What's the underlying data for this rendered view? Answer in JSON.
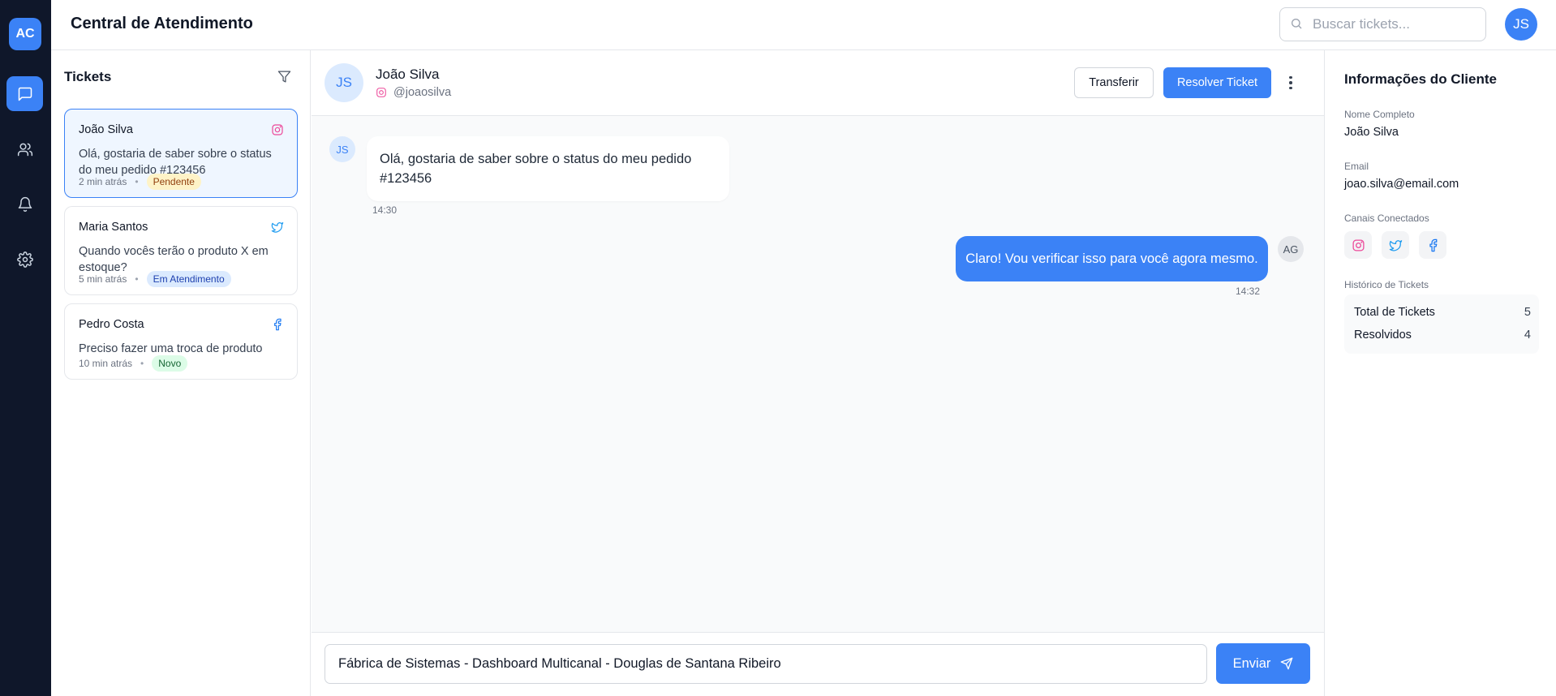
{
  "app": {
    "logo": "AC",
    "title": "Central de Atendimento",
    "user_avatar": "JS"
  },
  "search": {
    "placeholder": "Buscar tickets...",
    "icon": "search-icon"
  },
  "nav": {
    "items": [
      {
        "name": "messages",
        "icon": "message-square-icon",
        "active": true
      },
      {
        "name": "users",
        "icon": "users-icon",
        "active": false
      },
      {
        "name": "notifications",
        "icon": "bell-icon",
        "active": false
      },
      {
        "name": "settings",
        "icon": "gear-icon",
        "active": false
      }
    ]
  },
  "tickets": {
    "title": "Tickets",
    "items": [
      {
        "name": "João Silva",
        "channel": "instagram",
        "message": "Olá, gostaria de saber sobre o status do meu pedido #123456",
        "time": "2 min atrás",
        "status": "Pendente",
        "selected": true
      },
      {
        "name": "Maria Santos",
        "channel": "twitter",
        "message": "Quando vocês terão o produto X em estoque?",
        "time": "5 min atrás",
        "status": "Em Atendimento",
        "selected": false
      },
      {
        "name": "Pedro Costa",
        "channel": "facebook",
        "message": "Preciso fazer uma troca de produto",
        "time": "10 min atrás",
        "status": "Novo",
        "selected": false
      }
    ]
  },
  "chat": {
    "contact": {
      "initials": "JS",
      "name": "João Silva",
      "handle": "@joaosilva"
    },
    "actions": {
      "transfer": "Transferir",
      "resolve": "Resolver Ticket"
    },
    "messages": [
      {
        "from": "customer",
        "avatar": "JS",
        "text": "Olá, gostaria de saber sobre o status do meu pedido #123456",
        "time": "14:30"
      },
      {
        "from": "agent",
        "avatar": "AG",
        "text": "Claro! Vou verificar isso para você agora mesmo.",
        "time": "14:32"
      }
    ],
    "composer": {
      "value": "Fábrica de Sistemas - Dashboard Multicanal - Douglas de Santana Ribeiro",
      "send_label": "Enviar"
    }
  },
  "customer_info": {
    "title": "Informações do Cliente",
    "full_name_label": "Nome Completo",
    "full_name": "João Silva",
    "email_label": "Email",
    "email": "joao.silva@email.com",
    "channels_label": "Canais Conectados",
    "channels": [
      "instagram-icon",
      "twitter-icon",
      "facebook-icon"
    ],
    "history_label": "Histórico de Tickets",
    "history": [
      {
        "label": "Total de Tickets",
        "value": "5"
      },
      {
        "label": "Resolvidos",
        "value": "4"
      }
    ]
  },
  "colors": {
    "primary": "#3b82f6",
    "sidebar": "#0f172a",
    "instagram": "#ec4899",
    "twitter": "#1d9bf0",
    "facebook": "#1877f2"
  }
}
